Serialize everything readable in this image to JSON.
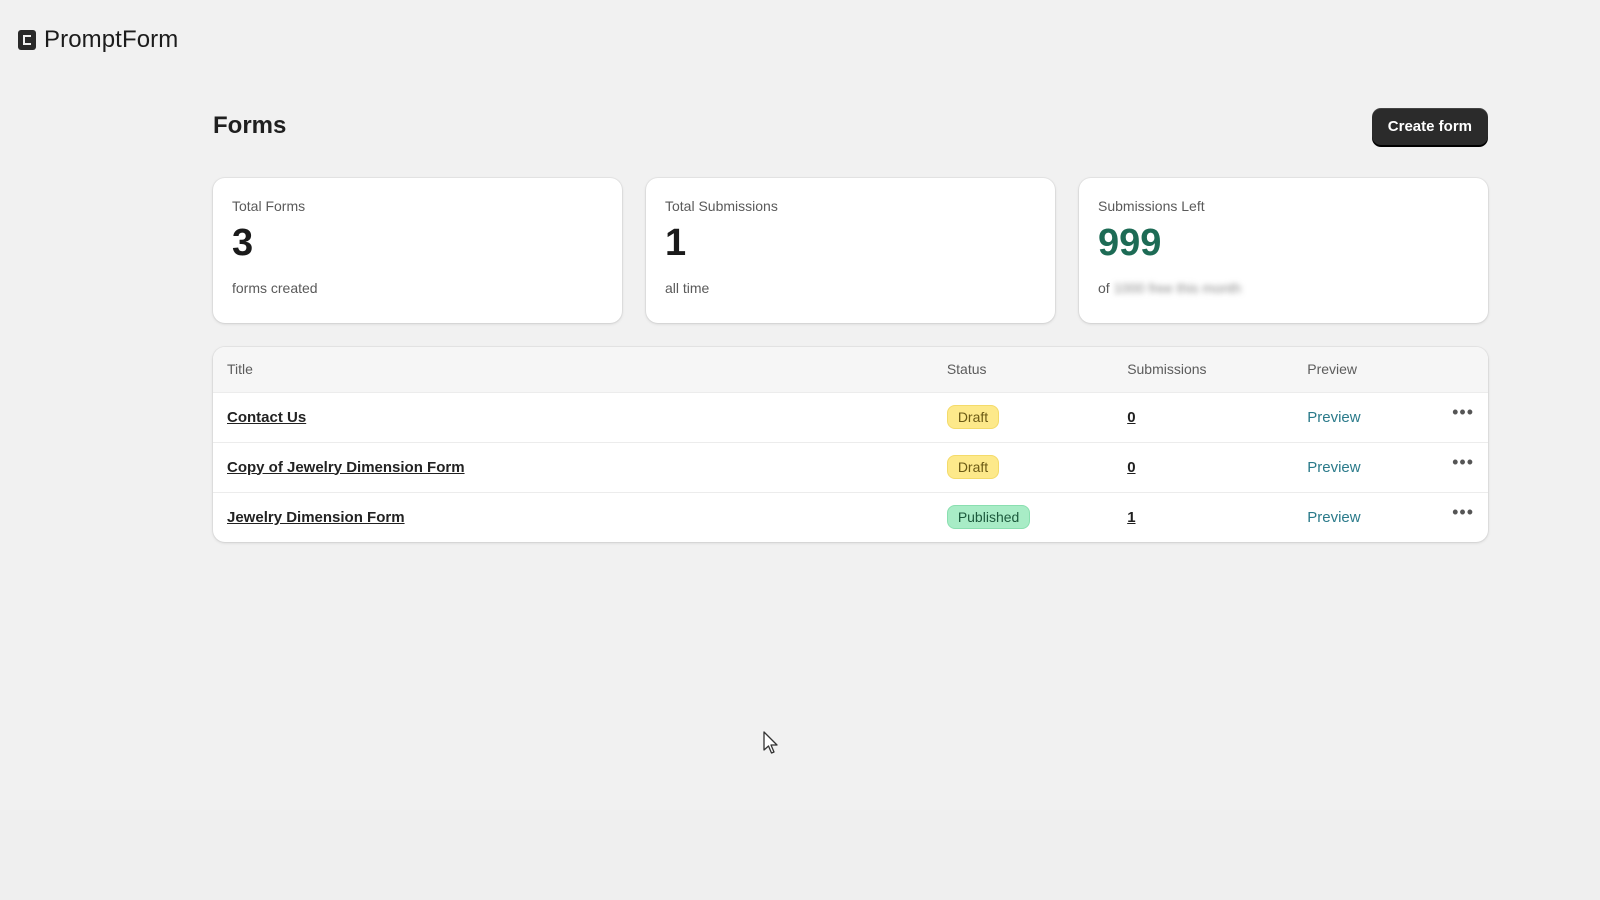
{
  "brand": {
    "name": "PromptForm",
    "logo_icon": "promptform-logo-icon"
  },
  "page": {
    "title": "Forms",
    "create_button_label": "Create form"
  },
  "stats": [
    {
      "label": "Total Forms",
      "value": "3",
      "sub": "forms created"
    },
    {
      "label": "Total Submissions",
      "value": "1",
      "sub": "all time"
    },
    {
      "label": "Submissions Left",
      "value": "999",
      "sub_prefix": "of",
      "sub_blurred": "1000 free this month",
      "value_color": "#1d6b55"
    }
  ],
  "table": {
    "headers": {
      "title": "Title",
      "status": "Status",
      "submissions": "Submissions",
      "preview": "Preview"
    },
    "rows": [
      {
        "title": "Contact Us",
        "status": "Draft",
        "submissions": "0",
        "preview": "Preview"
      },
      {
        "title": "Copy of Jewelry Dimension Form",
        "status": "Draft",
        "submissions": "0",
        "preview": "Preview"
      },
      {
        "title": "Jewelry Dimension Form",
        "status": "Published",
        "submissions": "1",
        "preview": "Preview"
      }
    ]
  },
  "colors": {
    "background": "#f1f1f1",
    "button_bg": "#2b2b2b",
    "draft_badge": "#fde98a",
    "published_badge": "#a8ecc6",
    "preview_link": "#2a7a8a"
  },
  "icons": {
    "row_menu": "more-horizontal-icon",
    "cursor": "mouse-cursor-icon"
  }
}
